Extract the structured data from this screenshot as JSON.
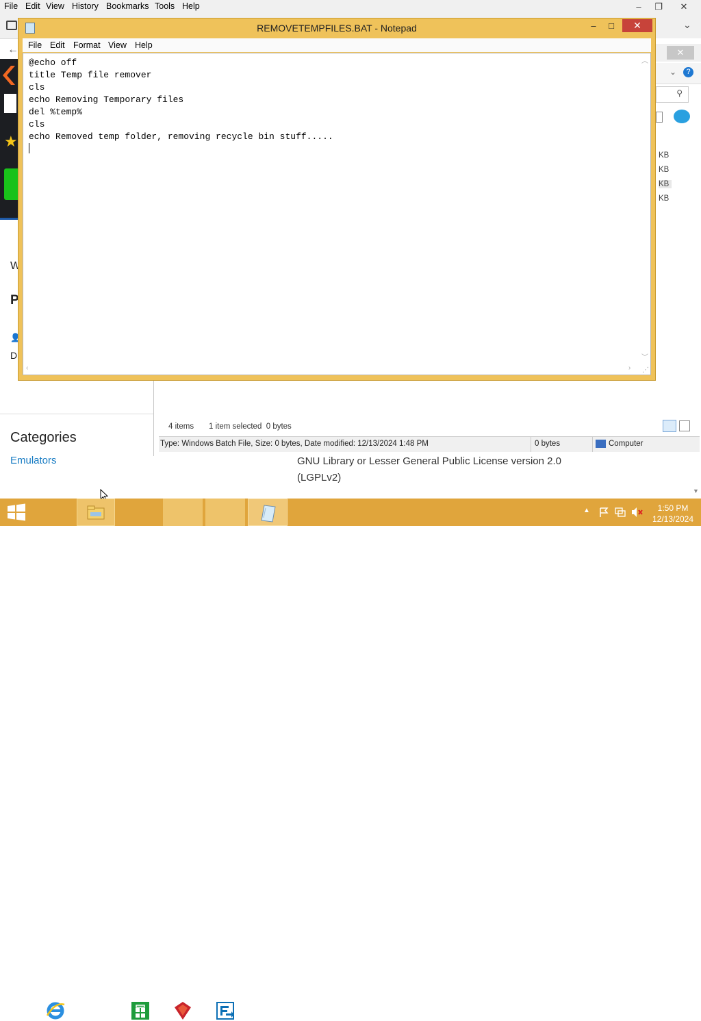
{
  "firefox": {
    "menu": [
      "File",
      "Edit",
      "View",
      "History",
      "Bookmarks",
      "Tools",
      "Help"
    ],
    "window_controls": {
      "minimize": "–",
      "restore": "❐",
      "close": "✕"
    }
  },
  "webpage": {
    "partial_w": "W",
    "partial_p": "P",
    "partial_d": "D",
    "categories_heading": "Categories",
    "category_link": "Emulators",
    "license_text": "GNU Library or Lesser General Public License version 2.0 (LGPLv2)"
  },
  "explorer": {
    "sizes": [
      "KB",
      "KB",
      "KB",
      "KB"
    ],
    "item_count": "4 items",
    "selection": "1 item selected  0 bytes",
    "details": "Type: Windows Batch File, Size: 0 bytes, Date modified: 12/13/2024 1:48 PM",
    "size_total": "0 bytes",
    "location": "Computer"
  },
  "notepad": {
    "title": "REMOVETEMPFILES.BAT - Notepad",
    "menu": [
      "File",
      "Edit",
      "Format",
      "View",
      "Help"
    ],
    "content": "@echo off\ntitle Temp file remover\ncls\necho Removing Temporary files\ndel %temp%\ncls\necho Removed temp folder, removing recycle bin stuff.....",
    "controls": {
      "minimize": "–",
      "maximize": "□",
      "close": "✕"
    }
  },
  "taskbar": {
    "apps": [
      "start-icon",
      "internet-explorer-icon",
      "file-explorer-icon",
      "store-icon",
      "filezilla-icon",
      "teamviewer-icon",
      "notepad-icon"
    ],
    "time": "1:50 PM",
    "date": "12/13/2024"
  }
}
